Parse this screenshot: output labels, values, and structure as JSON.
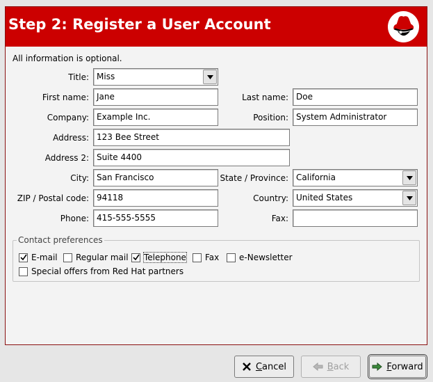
{
  "header": {
    "title": "Step 2: Register a User Account",
    "logo_icon": "red-hat-shadowman-logo"
  },
  "form": {
    "intro": "All information is optional.",
    "labels": {
      "title": "Title:",
      "first_name": "First name:",
      "last_name": "Last name:",
      "company": "Company:",
      "position": "Position:",
      "address": "Address:",
      "address2": "Address 2:",
      "city": "City:",
      "state": "State / Province:",
      "zip": "ZIP / Postal code:",
      "country": "Country:",
      "phone": "Phone:",
      "fax": "Fax:"
    },
    "values": {
      "title": "Miss",
      "first_name": "Jane",
      "last_name": "Doe",
      "company": "Example Inc.",
      "position": "System Administrator",
      "address": "123 Bee Street",
      "address2": "Suite 4400",
      "city": "San Francisco",
      "state": "California",
      "zip": "94118",
      "country": "United States",
      "phone": "415-555-5555",
      "fax": ""
    }
  },
  "contact_prefs": {
    "legend": "Contact preferences",
    "options": [
      {
        "label": "E-mail",
        "checked": true
      },
      {
        "label": "Regular mail",
        "checked": false
      },
      {
        "label": "Telephone",
        "checked": true
      },
      {
        "label": "Fax",
        "checked": false
      },
      {
        "label": "e-Newsletter",
        "checked": false
      },
      {
        "label": "Special offers from Red Hat partners",
        "checked": false
      }
    ]
  },
  "buttons": {
    "cancel": "Cancel",
    "back": "Back",
    "forward": "Forward"
  },
  "colors": {
    "header_bg": "#cc0000",
    "window_bg": "#e6e6e6"
  }
}
